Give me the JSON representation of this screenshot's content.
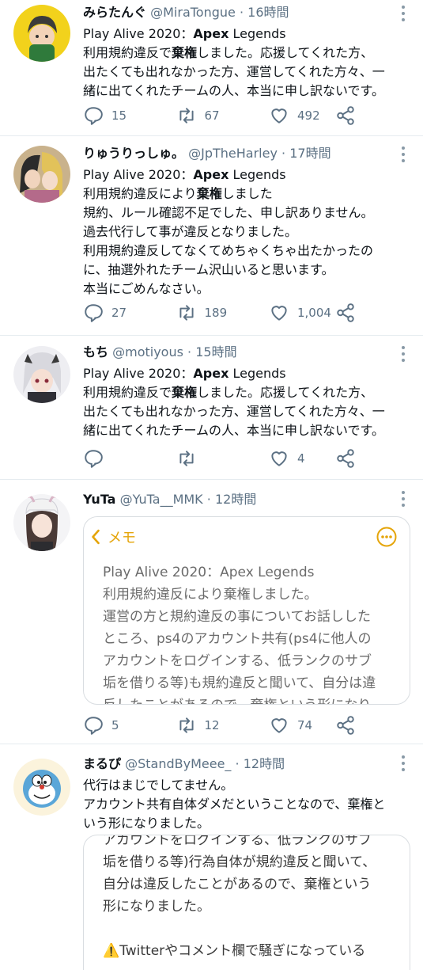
{
  "tweets": [
    {
      "name": "みらたんぐ",
      "handle": "@MiraTongue",
      "time": "16時間",
      "title_prefix": "Play Alive 2020：",
      "title_bold": "Apex",
      "title_suffix": " Legends",
      "text_a": "利用規約違反で",
      "text_bold": "棄権",
      "text_b": "しました。応援してくれた方、\n出たくても出れなかった方、運営してくれた方々、一\n緒に出てくれたチームの人、本当に申し訳ないです。",
      "replies": "15",
      "retweets": "67",
      "likes": "492"
    },
    {
      "name": "りゅうりっしゅ。",
      "handle": "@JpTheHarley",
      "time": "17時間",
      "title_prefix": "Play Alive 2020：",
      "title_bold": "Apex",
      "title_suffix": " Legends",
      "text_a": "利用規約違反により",
      "text_bold": "棄権",
      "text_b": "しました\n規約、ルール確認不足でした、申し訳ありません。\n過去代行して事が違反となりました。\n利用規約違反してなくてめちゃくちゃ出たかったの\nに、抽選外れたチーム沢山いると思います。\n本当にごめんなさい。",
      "replies": "27",
      "retweets": "189",
      "likes": "1,004"
    },
    {
      "name": "もち",
      "handle": "@motiyous",
      "time": "15時間",
      "title_prefix": "Play Alive 2020：",
      "title_bold": "Apex",
      "title_suffix": " Legends",
      "text_a": "利用規約違反で",
      "text_bold": "棄権",
      "text_b": "しました。応援してくれた方、\n出たくても出れなかった方、運営してくれた方々、一\n緒に出てくれたチームの人、本当に申し訳ないです。",
      "replies": "",
      "retweets": "",
      "likes": "4"
    },
    {
      "name": "YuTa",
      "handle": "@YuTa__MMK",
      "time": "12時間",
      "memo_back": "メモ",
      "memo_text": "Play Alive 2020：Apex Legends\n利用規約違反により棄権しました。\n運営の方と規約違反の事についてお話しした\nところ、ps4のアカウント共有(ps4に他人の\nアカウントをログインする、低ランクのサブ\n垢を借りる等)も規約違反と聞いて、自分は違\n反したことがあるので、棄権という形になり",
      "replies": "5",
      "retweets": "12",
      "likes": "74"
    },
    {
      "name": "まるぴ",
      "handle": "@StandByMeee_",
      "time": "12時間",
      "text": "代行はまじでしてません。\nアカウント共有自体ダメだということなので、棄権と\nいう形になりました。",
      "memo_text": "アカウントをログインする、低ランクのサブ\n垢を借りる等)行為自体が規約違反と聞いて、\n自分は違反したことがあるので、棄権という\n形になりました。\n\n⚠️Twitterやコメント欄で騒ぎになっている"
    }
  ],
  "colors": {
    "icon": "#5b7083",
    "divider": "#e6ecf0",
    "memo_accent": "#e5a50a"
  }
}
